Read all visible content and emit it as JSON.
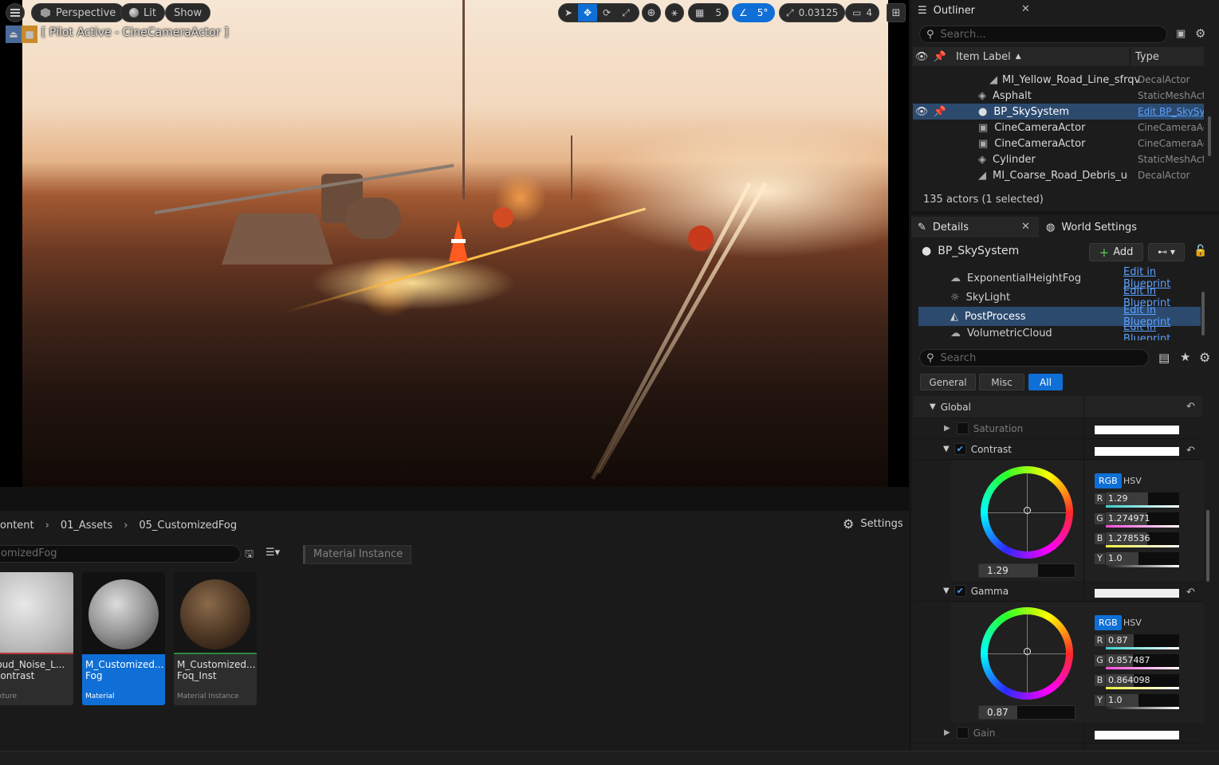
{
  "viewport": {
    "perspective_label": "Perspective",
    "lit_label": "Lit",
    "show_label": "Show",
    "pilot_label": "[ Pilot Active - CineCameraActor ]",
    "grid_value": "5",
    "angle_value": "5°",
    "scale_value": "0.03125",
    "camera_speed": "4"
  },
  "content_browser": {
    "breadcrumb": [
      "ontent",
      "01_Assets",
      "05_CustomizedFog"
    ],
    "settings_label": "Settings",
    "search_value": "omizedFog",
    "filter_chip": "Material Instance",
    "assets": [
      {
        "name": "loud_Noise_L... Contrast",
        "kind": "exture",
        "selected": false
      },
      {
        "name": "M_Customized... Fog",
        "kind": "Material",
        "selected": true
      },
      {
        "name": "M_Customized... Foq_Inst",
        "kind": "Material Instance",
        "selected": false
      }
    ]
  },
  "outliner": {
    "title": "Outliner",
    "search_placeholder": "Search...",
    "col_label": "Item Label",
    "col_type": "Type",
    "rows": [
      {
        "label": "MI_Yellow_Road_Line_sfrqv",
        "type": "DecalActor"
      },
      {
        "label": "Asphalt",
        "type": "StaticMeshAct"
      },
      {
        "label": "BP_SkySystem",
        "type": "Edit BP_SkySy"
      },
      {
        "label": "CineCameraActor",
        "type": "CineCameraAc"
      },
      {
        "label": "CineCameraActor",
        "type": "CineCameraAc"
      },
      {
        "label": "Cylinder",
        "type": "StaticMeshAct"
      },
      {
        "label": "MI_Coarse_Road_Debris_uckl",
        "type": "DecalActor"
      }
    ],
    "status": "135 actors (1 selected)"
  },
  "details": {
    "tab_details": "Details",
    "tab_world": "World Settings",
    "actor_name": "BP_SkySystem",
    "add_label": "Add",
    "components": [
      {
        "name": "ExponentialHeightFog",
        "edit": "Edit in Blueprint"
      },
      {
        "name": "SkyLight",
        "edit": "Edit in Blueprint"
      },
      {
        "name": "PostProcess",
        "edit": "Edit in Blueprint"
      },
      {
        "name": "VolumetricCloud",
        "edit": "Edit in Blueprint"
      }
    ],
    "search_placeholder": "Search",
    "filters": [
      "General",
      "Misc",
      "All"
    ],
    "section": "Global",
    "saturation_label": "Saturation",
    "contrast_label": "Contrast",
    "gamma_label": "Gamma",
    "gain_label": "Gain",
    "rgb_label": "RGB",
    "hsv_label": "HSV",
    "contrast": {
      "wheel_value": "1.29",
      "r": "1.29",
      "g": "1.274971",
      "b": "1.278536",
      "y": "1.0"
    },
    "gamma": {
      "wheel_value": "0.87",
      "r": "0.87",
      "g": "0.857487",
      "b": "0.864098",
      "y": "1.0"
    }
  },
  "colors": {
    "accent": "#0f6fd6",
    "link": "#5aa0ff",
    "selection": "#2c4a6e"
  }
}
